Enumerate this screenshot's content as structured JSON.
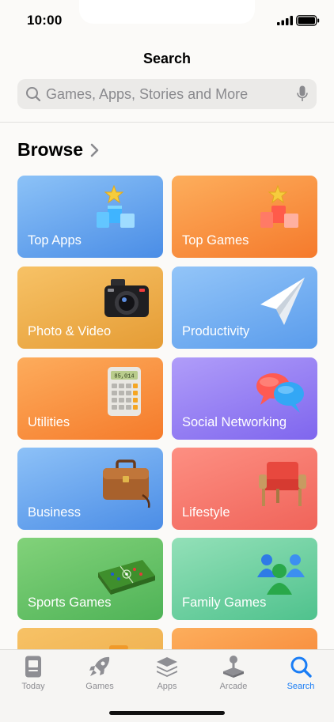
{
  "status": {
    "time": "10:00"
  },
  "header": {
    "title": "Search",
    "search_placeholder": "Games, Apps, Stories and More"
  },
  "browse": {
    "title": "Browse",
    "categories": [
      {
        "label": "Top Apps",
        "icon": "podium-star-icon",
        "color_from": "#8cc2f7",
        "color_to": "#4a8de6"
      },
      {
        "label": "Top Games",
        "icon": "podium-star-icon",
        "color_from": "#fdae5c",
        "color_to": "#f57a2c"
      },
      {
        "label": "Photo & Video",
        "icon": "camera-icon",
        "color_from": "#f7c266",
        "color_to": "#e59c35"
      },
      {
        "label": "Productivity",
        "icon": "paper-plane-icon",
        "color_from": "#93c5f8",
        "color_to": "#5a9cec"
      },
      {
        "label": "Utilities",
        "icon": "calculator-icon",
        "color_from": "#fdac5c",
        "color_to": "#f57b2b"
      },
      {
        "label": "Social Networking",
        "icon": "chat-bubbles-icon",
        "color_from": "#b09df9",
        "color_to": "#7f66ee"
      },
      {
        "label": "Business",
        "icon": "briefcase-icon",
        "color_from": "#8dc1f7",
        "color_to": "#4b8de6"
      },
      {
        "label": "Lifestyle",
        "icon": "armchair-icon",
        "color_from": "#fd8f82",
        "color_to": "#f0645a"
      },
      {
        "label": "Sports Games",
        "icon": "football-table-icon",
        "color_from": "#82d27a",
        "color_to": "#4fb357"
      },
      {
        "label": "Family Games",
        "icon": "game-pieces-icon",
        "color_from": "#93e0b8",
        "color_to": "#4fc28d"
      },
      {
        "label": "",
        "icon": "",
        "color_from": "#f7c266",
        "color_to": "#eba845"
      },
      {
        "label": "",
        "icon": "",
        "color_from": "#fdae5c",
        "color_to": "#f57a2c"
      }
    ]
  },
  "tab_bar": {
    "items": [
      {
        "label": "Today",
        "icon": "today-icon",
        "active": false
      },
      {
        "label": "Games",
        "icon": "rocket-icon",
        "active": false
      },
      {
        "label": "Apps",
        "icon": "layers-icon",
        "active": false
      },
      {
        "label": "Arcade",
        "icon": "joystick-icon",
        "active": false
      },
      {
        "label": "Search",
        "icon": "search-icon",
        "active": true
      }
    ],
    "accent": "#1a7df5",
    "inactive": "#8e8e93"
  }
}
